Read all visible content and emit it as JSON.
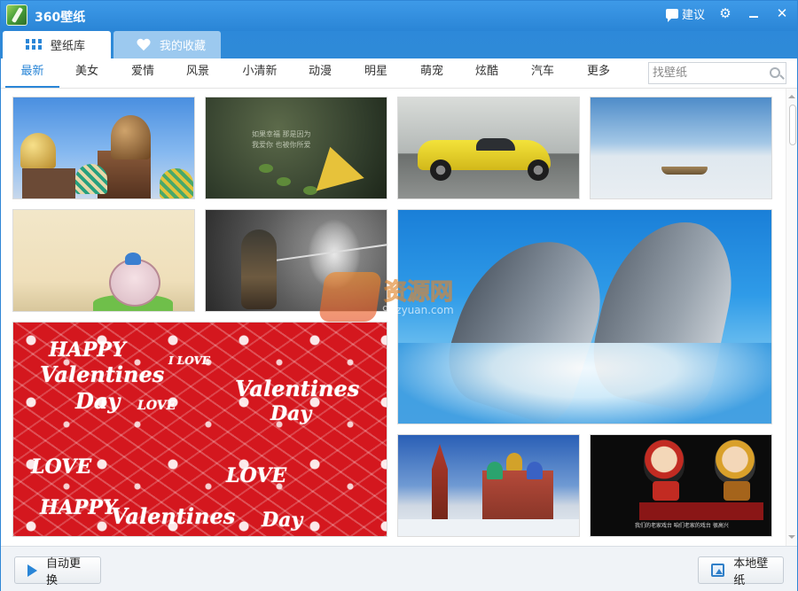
{
  "window": {
    "title": "360壁纸",
    "suggest_label": "建议",
    "close_glyph": "✕",
    "settings_glyph": "⚙"
  },
  "tabs": [
    {
      "label": "壁纸库",
      "icon": "grid-icon",
      "active": true
    },
    {
      "label": "我的收藏",
      "icon": "heart-icon",
      "active": false
    }
  ],
  "categories": [
    "最新",
    "美女",
    "爱情",
    "风景",
    "小清新",
    "动漫",
    "明星",
    "萌宠",
    "炫酷",
    "汽车",
    "更多"
  ],
  "active_category": "最新",
  "search": {
    "placeholder": "找壁纸"
  },
  "thumbnails": {
    "origami": {
      "text": "如果幸福 那是因为\n我爱你 也被你所爱"
    },
    "valentine": {
      "words": [
        "HAPPY",
        "Valentines",
        "Day",
        "LOVE",
        "I LOVE"
      ]
    },
    "opera": {
      "text": "我们的老家戏台 咱们老家的戏台 很高兴"
    }
  },
  "watermark": {
    "text": "资源网",
    "sub": "90zyuan.com"
  },
  "bottom": {
    "auto_change_label": "自动更换",
    "local_wallpaper_label": "本地壁纸"
  },
  "colors": {
    "accent": "#2a86d7",
    "titlebar": "#2f86d6",
    "tab_inactive": "#9cc9ef"
  }
}
